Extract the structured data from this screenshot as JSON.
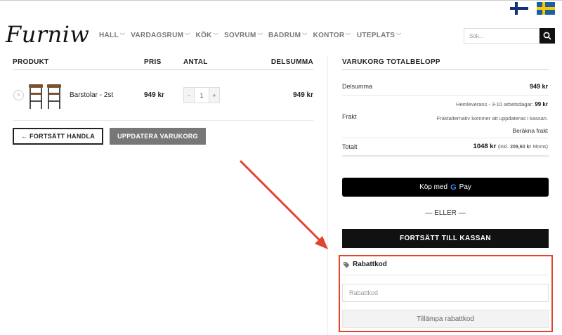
{
  "brand": {
    "logo": "Furniw"
  },
  "nav": [
    {
      "label": "HALL"
    },
    {
      "label": "VARDAGSRUM"
    },
    {
      "label": "KÖK"
    },
    {
      "label": "SOVRUM"
    },
    {
      "label": "BADRUM"
    },
    {
      "label": "KONTOR"
    },
    {
      "label": "UTEPLATS"
    }
  ],
  "search": {
    "placeholder": "Sök..."
  },
  "cart": {
    "headers": {
      "product": "PRODUKT",
      "price": "PRIS",
      "qty": "ANTAL",
      "subtotal": "DELSUMMA"
    },
    "items": [
      {
        "remove": "×",
        "name": "Barstolar - 2st",
        "price": "949 kr",
        "qty_minus": "-",
        "qty": "1",
        "qty_plus": "+",
        "subtotal": "949 kr"
      }
    ],
    "continue_label": "← FORTSÄTT HANDLA",
    "update_label": "UPPDATERA VARUKORG"
  },
  "totals": {
    "title": "VARUKORG TOTALBELOPP",
    "subtotal_label": "Delsumma",
    "subtotal_value": "949 kr",
    "shipping_label": "Frakt",
    "shipping_method": "Hemleverans - 3-10 arbetsdagar:",
    "shipping_price": "99 kr",
    "shipping_note": "Fraktalternativ kommer att uppdateras i kassan.",
    "shipping_calc": "Beräkna frakt",
    "total_label": "Totalt",
    "total_value": "1048 kr",
    "total_tax_prefix": "(inkl.",
    "total_tax_amount": "209,60 kr",
    "total_tax_suffix": "Moms)",
    "gpay_prefix": "Köp med",
    "gpay_g": "G",
    "gpay_suffix": "Pay",
    "or_label": "— ELLER —",
    "checkout_label": "FORTSÄTT TILL KASSAN"
  },
  "coupon": {
    "title": "Rabattkod",
    "placeholder": "Rabattkod",
    "apply_label": "Tillämpa rabattkod"
  },
  "colors": {
    "highlight": "#e2452f",
    "dark": "#111111",
    "muted": "#777777"
  }
}
